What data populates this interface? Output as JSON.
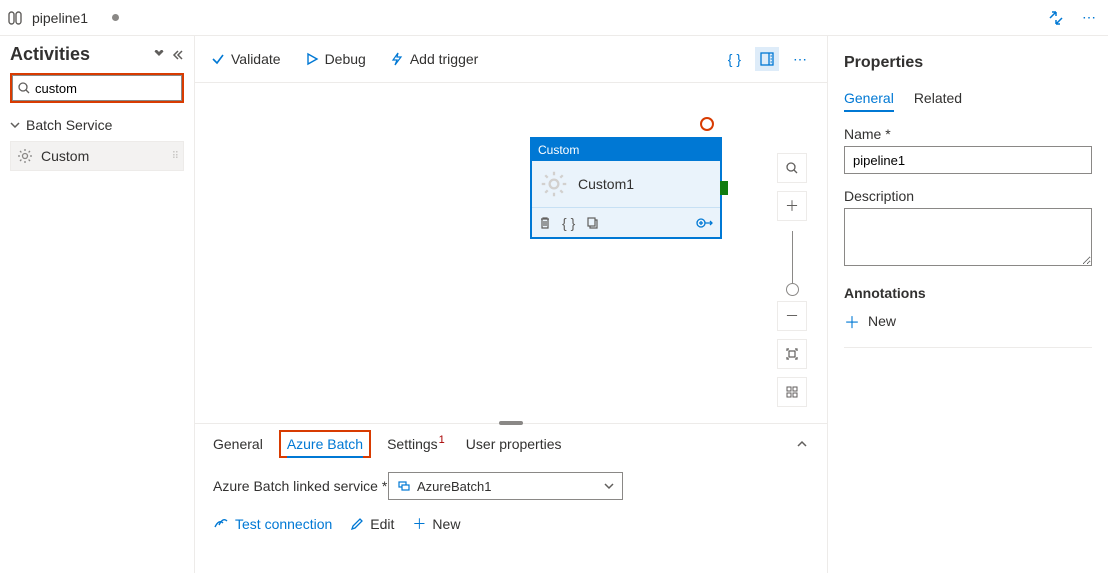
{
  "titlebar": {
    "title": "pipeline1"
  },
  "sidebar": {
    "heading": "Activities",
    "search_value": "custom",
    "search_placeholder": "",
    "group_label": "Batch Service",
    "item_label": "Custom"
  },
  "toolbar": {
    "validate": "Validate",
    "debug": "Debug",
    "add_trigger": "Add trigger"
  },
  "canvas": {
    "node_type": "Custom",
    "node_name": "Custom1"
  },
  "bottom": {
    "tab_general": "General",
    "tab_azure_batch": "Azure Batch",
    "tab_settings": "Settings",
    "settings_badge": "1",
    "tab_user_props": "User properties",
    "linked_service_label": "Azure Batch linked service *",
    "linked_service_value": "AzureBatch1",
    "test_connection": "Test connection",
    "edit": "Edit",
    "new": "New"
  },
  "props": {
    "heading": "Properties",
    "tab_general": "General",
    "tab_related": "Related",
    "name_label": "Name *",
    "name_value": "pipeline1",
    "desc_label": "Description",
    "desc_value": "",
    "ann_label": "Annotations",
    "new_label": "New"
  }
}
